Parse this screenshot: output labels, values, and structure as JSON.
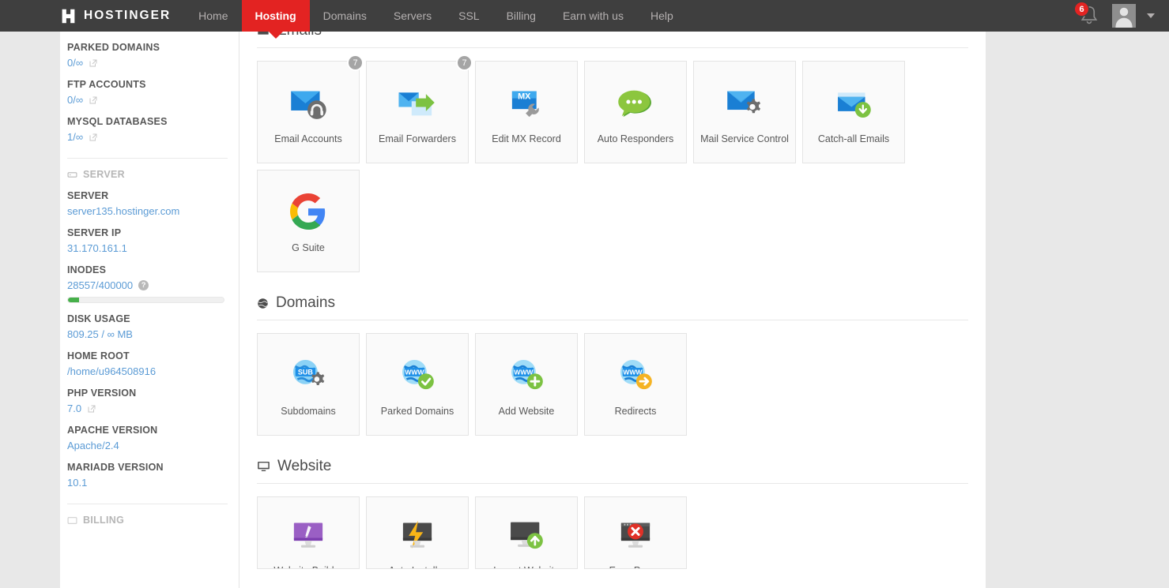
{
  "nav": {
    "brand": "HOSTINGER",
    "items": [
      {
        "label": "Home",
        "active": false
      },
      {
        "label": "Hosting",
        "active": true
      },
      {
        "label": "Domains",
        "active": false
      },
      {
        "label": "Servers",
        "active": false
      },
      {
        "label": "SSL",
        "active": false
      },
      {
        "label": "Billing",
        "active": false
      },
      {
        "label": "Earn with us",
        "active": false
      },
      {
        "label": "Help",
        "active": false
      }
    ],
    "notification_count": "6"
  },
  "sidebar": {
    "stats": [
      {
        "label": "PARKED DOMAINS",
        "value": "0/∞",
        "has_ext_link": true
      },
      {
        "label": "FTP ACCOUNTS",
        "value": "0/∞",
        "has_ext_link": true
      },
      {
        "label": "MYSQL DATABASES",
        "value": "1/∞",
        "has_ext_link": true
      }
    ],
    "server_section_label": "SERVER",
    "server_items": [
      {
        "label": "SERVER",
        "value": "server135.hostinger.com",
        "has_ext_link": false
      },
      {
        "label": "SERVER IP",
        "value": "31.170.161.1",
        "has_ext_link": false
      },
      {
        "label": "INODES",
        "value": "28557/400000",
        "has_ext_link": false,
        "has_help": true,
        "progress_percent": 7
      },
      {
        "label": "DISK USAGE",
        "value": "809.25 / ∞ MB",
        "has_ext_link": false
      },
      {
        "label": "HOME ROOT",
        "value": "/home/u964508916",
        "has_ext_link": false
      },
      {
        "label": "PHP VERSION",
        "value": "7.0",
        "has_ext_link": true
      },
      {
        "label": "APACHE VERSION",
        "value": "Apache/2.4",
        "has_ext_link": false
      },
      {
        "label": "MARIADB VERSION",
        "value": "10.1",
        "has_ext_link": false
      }
    ],
    "billing_section_label": "BILLING"
  },
  "main": {
    "sections": [
      {
        "id": "emails",
        "title": "Emails",
        "icon": "envelope-icon",
        "cards": [
          {
            "label": "Email Accounts",
            "icon": "email-accounts-icon",
            "badge": "7"
          },
          {
            "label": "Email Forwarders",
            "icon": "email-forwarders-icon",
            "badge": "7"
          },
          {
            "label": "Edit MX Record",
            "icon": "mx-record-icon",
            "badge": ""
          },
          {
            "label": "Auto Responders",
            "icon": "auto-responders-icon",
            "badge": ""
          },
          {
            "label": "Mail Service Control",
            "icon": "mail-service-control-icon",
            "badge": ""
          },
          {
            "label": "Catch-all Emails",
            "icon": "catch-all-emails-icon",
            "badge": ""
          },
          {
            "label": "G Suite",
            "icon": "g-suite-icon",
            "badge": ""
          }
        ]
      },
      {
        "id": "domains",
        "title": "Domains",
        "icon": "globe-icon",
        "cards": [
          {
            "label": "Subdomains",
            "icon": "subdomains-icon",
            "badge": ""
          },
          {
            "label": "Parked Domains",
            "icon": "parked-domains-icon",
            "badge": ""
          },
          {
            "label": "Add Website",
            "icon": "add-website-icon",
            "badge": ""
          },
          {
            "label": "Redirects",
            "icon": "redirects-icon",
            "badge": ""
          }
        ]
      },
      {
        "id": "website",
        "title": "Website",
        "icon": "monitor-icon",
        "cards": [
          {
            "label": "Website Builder",
            "icon": "website-builder-icon",
            "badge": ""
          },
          {
            "label": "Auto Installer",
            "icon": "auto-installer-icon",
            "badge": ""
          },
          {
            "label": "Import Website",
            "icon": "import-website-icon",
            "badge": ""
          },
          {
            "label": "Error Pages",
            "icon": "error-pages-icon",
            "badge": ""
          }
        ]
      }
    ]
  },
  "colors": {
    "brand_red": "#e32322",
    "nav_bg": "#3f3f3f",
    "link_blue": "#5b9bd5",
    "progress_green": "#46b04a"
  }
}
